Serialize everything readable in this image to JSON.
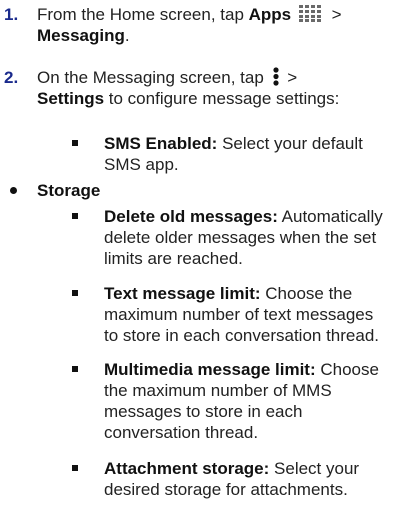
{
  "steps": [
    {
      "number": "1.",
      "text_before": "From the Home screen, tap ",
      "bold1": "Apps",
      "icon": "apps-grid-icon",
      "sep": " >",
      "bold2": "Messaging",
      "end": "."
    },
    {
      "number": "2.",
      "text_before": "On the Messaging screen, tap",
      "icon": "menu-kebab-icon",
      "sep": " >",
      "bold1": "Settings",
      "text_after": " to configure message settings:"
    }
  ],
  "sms": {
    "label": "SMS Enabled:",
    "desc_line1": " Select your default",
    "desc_line2": "SMS app."
  },
  "storage": {
    "heading": "Storage",
    "items": [
      {
        "label": "Delete old messages:",
        "desc_line1": " Automatically",
        "desc_line2": "delete older messages when the set",
        "desc_line3": "limits are reached."
      },
      {
        "label": "Text message limit:",
        "desc_line1": " Choose the",
        "desc_line2": "maximum number of text messages",
        "desc_line3": "to store in each conversation thread."
      },
      {
        "label": "Multimedia message limit:",
        "desc_line1": " Choose",
        "desc_line2": "the maximum number of MMS",
        "desc_line3": "messages to store in each",
        "desc_line4": "conversation thread."
      },
      {
        "label": "Attachment storage:",
        "desc_line1": " Select your",
        "desc_line2": "desired storage for attachments."
      }
    ]
  },
  "colors": {
    "step_number": "#1a2a8c",
    "text": "#222222",
    "bullet": "#111111"
  }
}
